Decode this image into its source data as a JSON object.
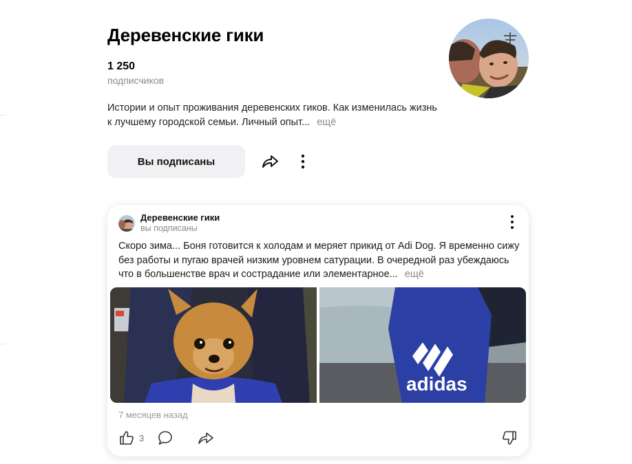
{
  "channel": {
    "title": "Деревенские гики",
    "subscribers_count": "1 250",
    "subscribers_label": "подписчиков",
    "description": "Истории и опыт проживания деревенских гиков. Как изменилась жизнь к лучшему городской семьи. Личный опыт...",
    "more": "ещё",
    "subscribed_label": "Вы подписаны"
  },
  "post": {
    "author": "Деревенские гики",
    "author_status": "вы подписаны",
    "text": "Скоро зима... Боня готовится к холодам и меряет прикид от Adi Dog. Я временно сижу без работы и пугаю врачей низким уровнем сатурации. В очередной раз убеждаюсь что в большенстве врач и сострадание или элементарное...",
    "more": "ещё",
    "time": "7 месяцев назад",
    "likes": "3",
    "images": [
      "dog-in-blue-hoodie-photo",
      "adidas-hoodie-closeup-photo"
    ]
  },
  "colors": {
    "muted": "#8a8a8a",
    "button_bg": "#f1f1f3",
    "card_shadow": "rgba(0,0,0,0.12)"
  },
  "icons": [
    "share-icon",
    "more-vertical-icon",
    "like-icon",
    "comment-icon",
    "dislike-icon"
  ]
}
